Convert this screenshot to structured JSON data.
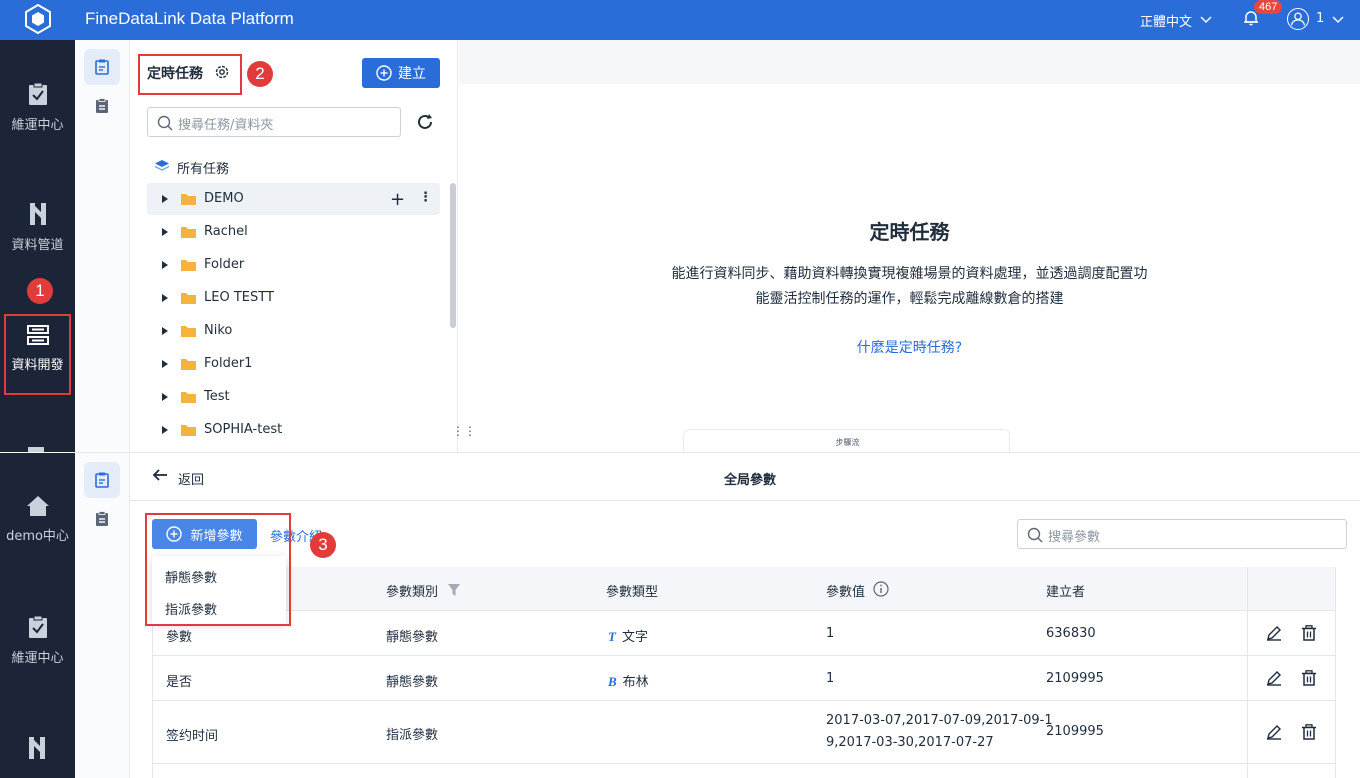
{
  "app": {
    "title": "FineDataLink Data Platform",
    "language": "正體中文",
    "notification_count": "467",
    "user": "1"
  },
  "sidebar_top": {
    "items": [
      {
        "label": "維運中心",
        "icon": "clipboard-check-icon"
      },
      {
        "label": "資料管道",
        "icon": "pipeline-icon"
      },
      {
        "label": "資料開發",
        "icon": "data-dev-icon",
        "active": true
      }
    ]
  },
  "sidebar_bottom": {
    "items": [
      {
        "label": "demo中心",
        "icon": "home-icon"
      },
      {
        "label": "維運中心",
        "icon": "clipboard-check-icon"
      }
    ]
  },
  "tree": {
    "title": "定時任務",
    "create_label": "建立",
    "search_placeholder": "搜尋任務/資料夾",
    "root_label": "所有任務",
    "folders": [
      "DEMO",
      "Rachel",
      "Folder",
      "LEO TESTT",
      "Niko",
      "Folder1",
      "Test",
      "SOPHIA-test"
    ]
  },
  "empty_state": {
    "title": "定時任務",
    "description": "能進行資料同步、藉助資料轉換實現複雜場景的資料處理，並透過調度配置功能靈活控制任務的運作，輕鬆完成離線數倉的搭建",
    "link": "什麼是定時任務?",
    "card_label": "步驟流"
  },
  "params": {
    "back_label": "返回",
    "title": "全局參數",
    "add_label": "新增參數",
    "intro_link": "參數介紹",
    "search_placeholder": "搜尋參數",
    "dropdown": [
      "靜態參數",
      "指派參數"
    ],
    "columns": [
      "參數類別",
      "參數類型",
      "參數值",
      "建立者"
    ],
    "rows": [
      {
        "name": "參數",
        "category": "靜態參數",
        "type_icon": "T",
        "type": "文字",
        "value": "1",
        "creator": "636830"
      },
      {
        "name": "是否",
        "category": "靜態參數",
        "type_icon": "B",
        "type": "布林",
        "value": "1",
        "creator": "2109995"
      },
      {
        "name": "签约时间",
        "category": "指派參數",
        "type_icon": "",
        "type": "",
        "value_line1": "2017-03-07,2017-07-09,2017-09-1",
        "value_line2": "9,2017-03-30,2017-07-27",
        "creator": "2109995"
      }
    ]
  },
  "annotations": {
    "one": "1",
    "two": "2",
    "three": "3"
  },
  "colors": {
    "brand": "#2a6dd8",
    "sidebar": "#1c2538",
    "annotation": "#e23b3b"
  }
}
